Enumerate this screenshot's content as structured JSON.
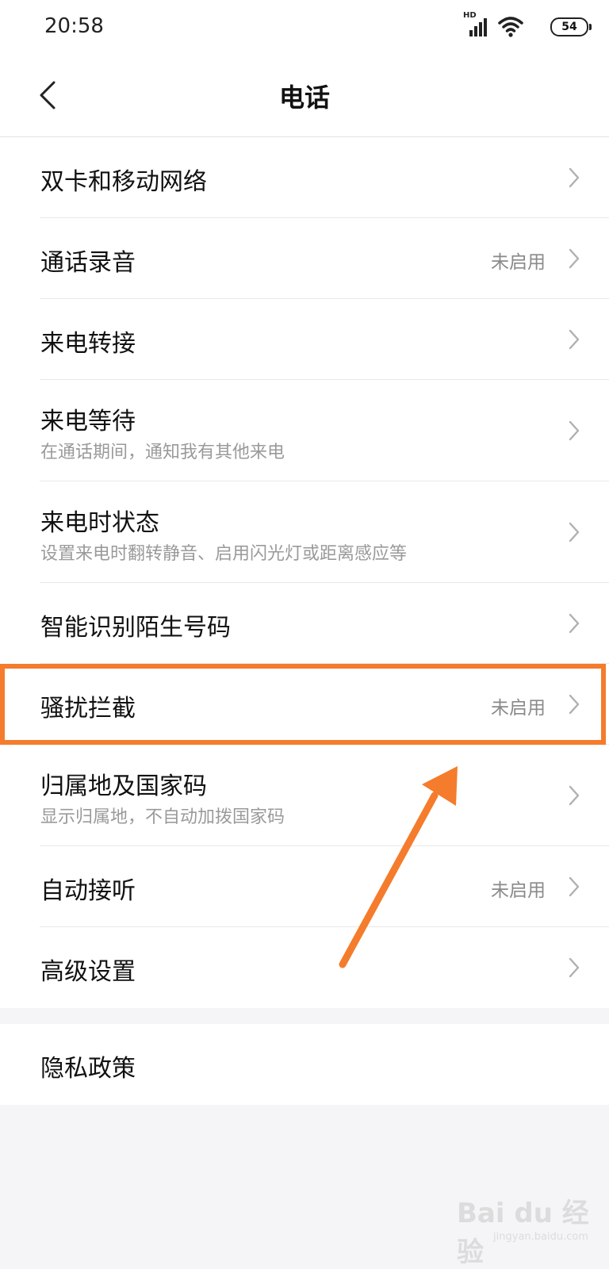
{
  "status_bar": {
    "time": "20:58",
    "network_label": "HD",
    "battery": "54"
  },
  "header": {
    "title": "电话"
  },
  "rows": [
    {
      "title": "双卡和移动网络",
      "subtitle": "",
      "value": ""
    },
    {
      "title": "通话录音",
      "subtitle": "",
      "value": "未启用"
    },
    {
      "title": "来电转接",
      "subtitle": "",
      "value": ""
    },
    {
      "title": "来电等待",
      "subtitle": "在通话期间，通知我有其他来电",
      "value": ""
    },
    {
      "title": "来电时状态",
      "subtitle": "设置来电时翻转静音、启用闪光灯或距离感应等",
      "value": ""
    },
    {
      "title": "智能识别陌生号码",
      "subtitle": "",
      "value": ""
    },
    {
      "title": "骚扰拦截",
      "subtitle": "",
      "value": "未启用"
    },
    {
      "title": "归属地及国家码",
      "subtitle": "显示归属地，不自动加拨国家码",
      "value": ""
    },
    {
      "title": "自动接听",
      "subtitle": "",
      "value": "未启用"
    },
    {
      "title": "高级设置",
      "subtitle": "",
      "value": ""
    }
  ],
  "privacy": {
    "title": "隐私政策"
  },
  "annotation": {
    "color": "#f47c2c"
  },
  "watermark": {
    "brand": "Bai du 经验",
    "url": "jingyan.baidu.com"
  }
}
